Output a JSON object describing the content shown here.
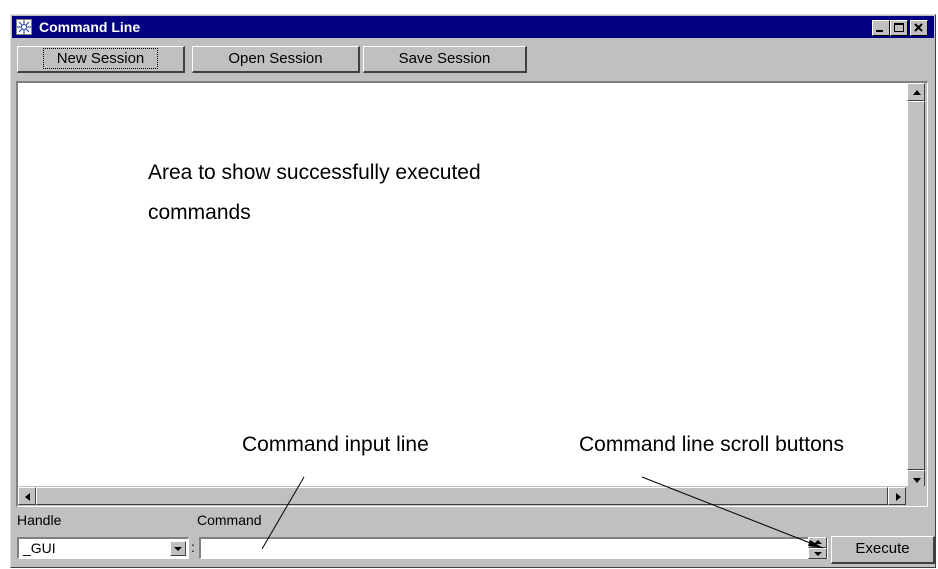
{
  "window": {
    "title": "Command Line",
    "controls": [
      "minimize-icon",
      "maximize-icon",
      "close-icon"
    ]
  },
  "toolbar": {
    "new_session": "New Session",
    "open_session": "Open Session",
    "save_session": "Save Session"
  },
  "output": {
    "annotation_line1": "Area to show successfully executed",
    "annotation_line2": "commands"
  },
  "annotations": {
    "command_input_line": "Command input line",
    "scroll_buttons": "Command line scroll buttons"
  },
  "bottom": {
    "handle_label": "Handle",
    "handle_value": "_GUI",
    "separator": ":",
    "command_label": "Command",
    "command_value": "",
    "execute": "Execute"
  },
  "colors": {
    "titlebar": "#000080",
    "face": "#c0c0c0"
  }
}
